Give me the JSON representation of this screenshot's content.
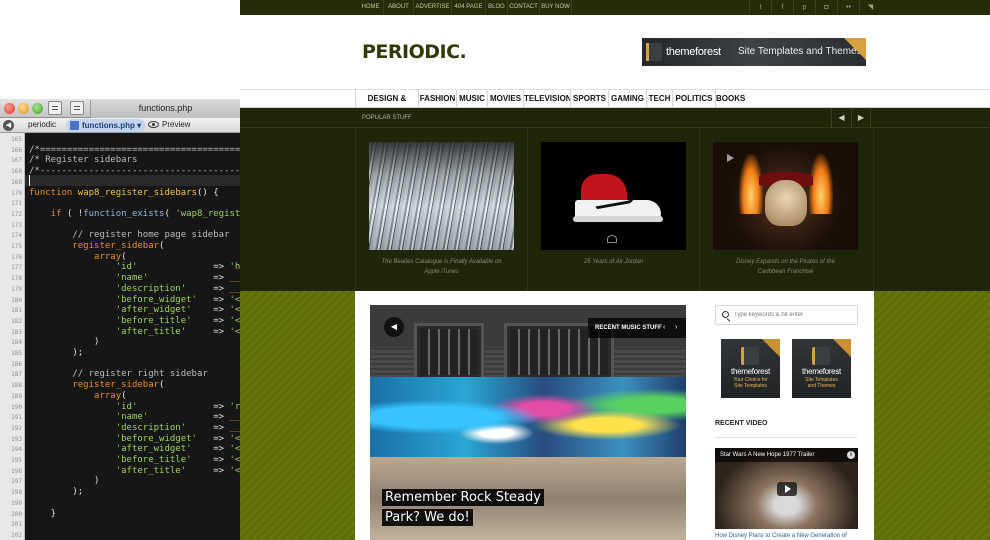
{
  "editor": {
    "tab_title": "functions.php",
    "breadcrumb": {
      "project": "periodic",
      "file": "functions.php",
      "file_menu": "▾",
      "preview": "Preview"
    },
    "line_numbers": [
      "165",
      "166",
      "167",
      "168",
      "169",
      "170",
      "171",
      "172",
      "173",
      "174",
      "175",
      "176",
      "177",
      "178",
      "179",
      "180",
      "181",
      "182",
      "183",
      "184",
      "185",
      "186",
      "187",
      "188",
      "189",
      "190",
      "191",
      "192",
      "193",
      "194",
      "195",
      "196",
      "197",
      "198",
      "199",
      "200",
      "201",
      "202"
    ],
    "code_lines": [
      {
        "segments": [
          {
            "t": "",
            "c": "#d0d0d0"
          }
        ]
      },
      {
        "segments": [
          {
            "t": "/*==========================================",
            "c": "#bcbcbc"
          }
        ]
      },
      {
        "segments": [
          {
            "t": "/* Register sidebars",
            "c": "#bcbcbc"
          }
        ]
      },
      {
        "segments": [
          {
            "t": "/*------------------------------------------",
            "c": "#bcbcbc"
          }
        ]
      },
      {
        "segments": [
          {
            "t": "",
            "c": "#d0d0d0"
          }
        ]
      },
      {
        "segments": [
          {
            "t": "function ",
            "c": "#f08d1d"
          },
          {
            "t": "wap8_register_sidebars",
            "c": "#f0c93a"
          },
          {
            "t": "() {",
            "c": "#e0e0e0"
          }
        ]
      },
      {
        "segments": [
          {
            "t": "",
            "c": "#d0d0d0"
          }
        ]
      },
      {
        "segments": [
          {
            "t": "    if ",
            "c": "#f08d1d"
          },
          {
            "t": "( !",
            "c": "#e0e0e0"
          },
          {
            "t": "function_exists",
            "c": "#8fb6e0"
          },
          {
            "t": "( ",
            "c": "#e0e0e0"
          },
          {
            "t": "'wap8_register_",
            "c": "#9dd35c"
          }
        ]
      },
      {
        "segments": [
          {
            "t": "",
            "c": "#d0d0d0"
          }
        ]
      },
      {
        "segments": [
          {
            "t": "        // register home page sidebar",
            "c": "#bcbcbc"
          }
        ]
      },
      {
        "segments": [
          {
            "t": "        register_sidebar",
            "c": "#f08d1d"
          },
          {
            "t": "(",
            "c": "#e0e0e0"
          }
        ]
      },
      {
        "segments": [
          {
            "t": "            array",
            "c": "#f08d1d"
          },
          {
            "t": "(",
            "c": "#e0e0e0"
          }
        ]
      },
      {
        "segments": [
          {
            "t": "                'id'",
            "c": "#9dd35c"
          },
          {
            "t": "              => ",
            "c": "#e0e0e0"
          },
          {
            "t": "'home',",
            "c": "#9dd35c"
          }
        ]
      },
      {
        "segments": [
          {
            "t": "                'name'",
            "c": "#9dd35c"
          },
          {
            "t": "            => ",
            "c": "#e0e0e0"
          },
          {
            "t": "__( ",
            "c": "#f08d1d"
          },
          {
            "t": "'Si",
            "c": "#9dd35c"
          }
        ]
      },
      {
        "segments": [
          {
            "t": "                'description'",
            "c": "#9dd35c"
          },
          {
            "t": "     => ",
            "c": "#e0e0e0"
          },
          {
            "t": "__( ",
            "c": "#f08d1d"
          },
          {
            "t": "'Di",
            "c": "#9dd35c"
          }
        ]
      },
      {
        "segments": [
          {
            "t": "                'before_widget'",
            "c": "#9dd35c"
          },
          {
            "t": "   => ",
            "c": "#e0e0e0"
          },
          {
            "t": "'<div i",
            "c": "#9dd35c"
          }
        ]
      },
      {
        "segments": [
          {
            "t": "                'after_widget'",
            "c": "#9dd35c"
          },
          {
            "t": "    => ",
            "c": "#e0e0e0"
          },
          {
            "t": "'</div>",
            "c": "#9dd35c"
          }
        ]
      },
      {
        "segments": [
          {
            "t": "                'before_title'",
            "c": "#9dd35c"
          },
          {
            "t": "    => ",
            "c": "#e0e0e0"
          },
          {
            "t": "'<h3 cl",
            "c": "#9dd35c"
          }
        ]
      },
      {
        "segments": [
          {
            "t": "                'after_title'",
            "c": "#9dd35c"
          },
          {
            "t": "     => ",
            "c": "#e0e0e0"
          },
          {
            "t": "'</h3>'",
            "c": "#9dd35c"
          }
        ]
      },
      {
        "segments": [
          {
            "t": "            )",
            "c": "#e0e0e0"
          }
        ]
      },
      {
        "segments": [
          {
            "t": "        );",
            "c": "#e0e0e0"
          }
        ]
      },
      {
        "segments": [
          {
            "t": "",
            "c": "#d0d0d0"
          }
        ]
      },
      {
        "segments": [
          {
            "t": "        // register right sidebar",
            "c": "#bcbcbc"
          }
        ]
      },
      {
        "segments": [
          {
            "t": "        register_sidebar",
            "c": "#f08d1d"
          },
          {
            "t": "(",
            "c": "#e0e0e0"
          }
        ]
      },
      {
        "segments": [
          {
            "t": "            array",
            "c": "#f08d1d"
          },
          {
            "t": "(",
            "c": "#e0e0e0"
          }
        ]
      },
      {
        "segments": [
          {
            "t": "                'id'",
            "c": "#9dd35c"
          },
          {
            "t": "              => ",
            "c": "#e0e0e0"
          },
          {
            "t": "'right'",
            "c": "#9dd35c"
          }
        ]
      },
      {
        "segments": [
          {
            "t": "                'name'",
            "c": "#9dd35c"
          },
          {
            "t": "            => ",
            "c": "#e0e0e0"
          },
          {
            "t": "__( ",
            "c": "#f08d1d"
          },
          {
            "t": "'Ri",
            "c": "#9dd35c"
          }
        ]
      },
      {
        "segments": [
          {
            "t": "                'description'",
            "c": "#9dd35c"
          },
          {
            "t": "     => ",
            "c": "#e0e0e0"
          },
          {
            "t": "__( ",
            "c": "#f08d1d"
          },
          {
            "t": "'Di",
            "c": "#9dd35c"
          }
        ]
      },
      {
        "segments": [
          {
            "t": "                'before_widget'",
            "c": "#9dd35c"
          },
          {
            "t": "   => ",
            "c": "#e0e0e0"
          },
          {
            "t": "'<div i",
            "c": "#9dd35c"
          }
        ]
      },
      {
        "segments": [
          {
            "t": "                'after_widget'",
            "c": "#9dd35c"
          },
          {
            "t": "    => ",
            "c": "#e0e0e0"
          },
          {
            "t": "'</div>",
            "c": "#9dd35c"
          }
        ]
      },
      {
        "segments": [
          {
            "t": "                'before_title'",
            "c": "#9dd35c"
          },
          {
            "t": "    => ",
            "c": "#e0e0e0"
          },
          {
            "t": "'<h3 cl",
            "c": "#9dd35c"
          }
        ]
      },
      {
        "segments": [
          {
            "t": "                'after_title'",
            "c": "#9dd35c"
          },
          {
            "t": "     => ",
            "c": "#e0e0e0"
          },
          {
            "t": "'</h3>'",
            "c": "#9dd35c"
          }
        ]
      },
      {
        "segments": [
          {
            "t": "            )",
            "c": "#e0e0e0"
          }
        ]
      },
      {
        "segments": [
          {
            "t": "        );",
            "c": "#e0e0e0"
          }
        ]
      },
      {
        "segments": [
          {
            "t": "",
            "c": "#d0d0d0"
          }
        ]
      },
      {
        "segments": [
          {
            "t": "    }",
            "c": "#e0e0e0"
          }
        ]
      },
      {
        "segments": [
          {
            "t": "",
            "c": "#d0d0d0"
          }
        ]
      },
      {
        "segments": [
          {
            "t": "",
            "c": "#d0d0d0"
          }
        ]
      }
    ]
  },
  "site": {
    "topnav": [
      "HOME",
      "ABOUT",
      "ADVERTISE",
      "404 PAGE",
      "BLOG",
      "CONTACT",
      "BUY NOW"
    ],
    "social": [
      {
        "icon": "twitter-icon",
        "glyph": "t"
      },
      {
        "icon": "facebook-icon",
        "glyph": "f"
      },
      {
        "icon": "pinterest-icon",
        "glyph": "p"
      },
      {
        "icon": "instagram-icon",
        "glyph": "◘"
      },
      {
        "icon": "flickr-icon",
        "glyph": "••"
      },
      {
        "icon": "rss-icon",
        "glyph": "◥"
      }
    ],
    "logo": "PERIODIC.",
    "ad_banner": {
      "brand": "themeforest",
      "tagline": "Site Templates and Themes"
    },
    "mainnav": [
      "DESIGN & DECOR",
      "FASHION",
      "MUSIC",
      "MOVIES",
      "TELEVISION",
      "SPORTS",
      "GAMING",
      "TECH",
      "POLITICS",
      "BOOKS"
    ],
    "popular": {
      "title": "POPULAR STUFF",
      "prev": "◀",
      "next": "▶",
      "items": [
        {
          "caption": "The Beatles Catalogue is Finally Available on Apple iTunes"
        },
        {
          "caption": "25 Years of Air Jordan"
        },
        {
          "caption": "Disney Expands on the Pirates of the Caribbean Franchise"
        }
      ]
    },
    "feature": {
      "label": "RECENT MUSIC STUFF",
      "prev": "‹",
      "next": "›",
      "title_lines": [
        "Remember Rock Steady",
        "Park? We do!"
      ]
    },
    "search": {
      "placeholder": "Type keywords & hit enter"
    },
    "side_ads": [
      {
        "brand": "themeforest",
        "tag_line1": "Your Choice for",
        "tag_line2": "Site Templates"
      },
      {
        "brand": "themeforest",
        "tag_line1": "Site Templates",
        "tag_line2": "and Themes"
      }
    ],
    "recent_video": {
      "title": "RECENT VIDEO",
      "video_title": "Star Wars A New Hope 1977 Trailer",
      "info": "i",
      "caption": "How Disney Plans to Create a New Generation of"
    }
  },
  "colors": {
    "topbar": "#262c09",
    "popular_bg": "#20260a",
    "content_bg": "#5e6b09",
    "logo": "#2f3a05",
    "themeforest_orange": "#d4a240"
  }
}
